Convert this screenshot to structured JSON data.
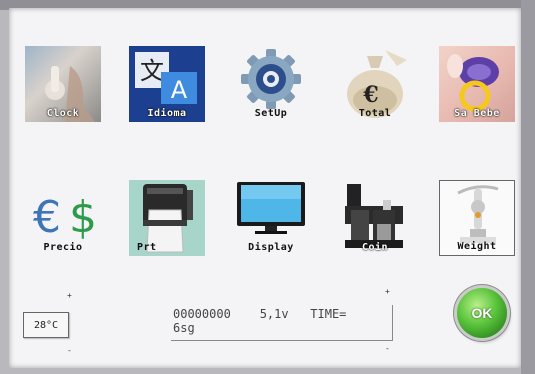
{
  "menu": {
    "row1": [
      {
        "id": "clock",
        "label": "Clock",
        "icon": "clock-photo-icon"
      },
      {
        "id": "idioma",
        "label": "Idioma",
        "icon": "translate-icon"
      },
      {
        "id": "setup",
        "label": "SetUp",
        "icon": "gear-icon"
      },
      {
        "id": "total",
        "label": "Total",
        "icon": "money-bag-icon"
      },
      {
        "id": "sabebe",
        "label": "Sa Bebe",
        "icon": "pacifier-icon"
      }
    ],
    "row2": [
      {
        "id": "precio",
        "label": "Precio",
        "icon": "euro-dollar-icon"
      },
      {
        "id": "prt",
        "label": "Prt",
        "icon": "printer-icon"
      },
      {
        "id": "display",
        "label": "Display",
        "icon": "monitor-icon"
      },
      {
        "id": "coin",
        "label": "Coin",
        "icon": "coin-mechanism-icon"
      },
      {
        "id": "weight",
        "label": "Weight",
        "icon": "scale-icon"
      }
    ]
  },
  "footer": {
    "temperature": "28°C",
    "status_line1": "00000000    5,1v   TIME=",
    "status_line2": "6sg",
    "ok_label": "OK"
  },
  "colors": {
    "screen_bg": "#f4f4f6",
    "ok_green": "#58c23b",
    "idioma_blue": "#1d3f8f"
  }
}
